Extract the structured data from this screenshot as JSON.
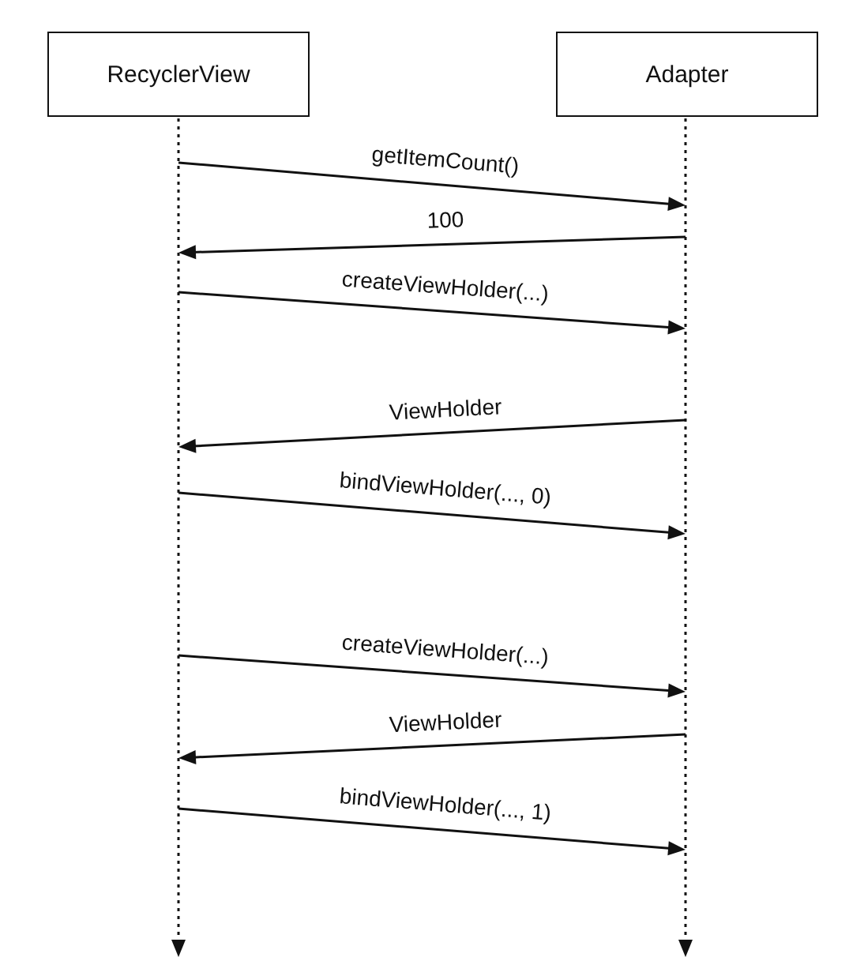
{
  "participants": [
    {
      "label": "RecyclerView"
    },
    {
      "label": "Adapter"
    }
  ],
  "messages": [
    {
      "label": "getItemCount()",
      "kind": "call"
    },
    {
      "label": "100",
      "kind": "reply"
    },
    {
      "label": "createViewHolder(...)",
      "kind": "call"
    },
    {
      "label": "ViewHolder",
      "kind": "reply"
    },
    {
      "label": "bindViewHolder(..., 0)",
      "kind": "call"
    },
    {
      "label": "createViewHolder(...)",
      "kind": "call"
    },
    {
      "label": "ViewHolder",
      "kind": "reply"
    },
    {
      "label": "bindViewHolder(..., 1)",
      "kind": "call"
    }
  ]
}
